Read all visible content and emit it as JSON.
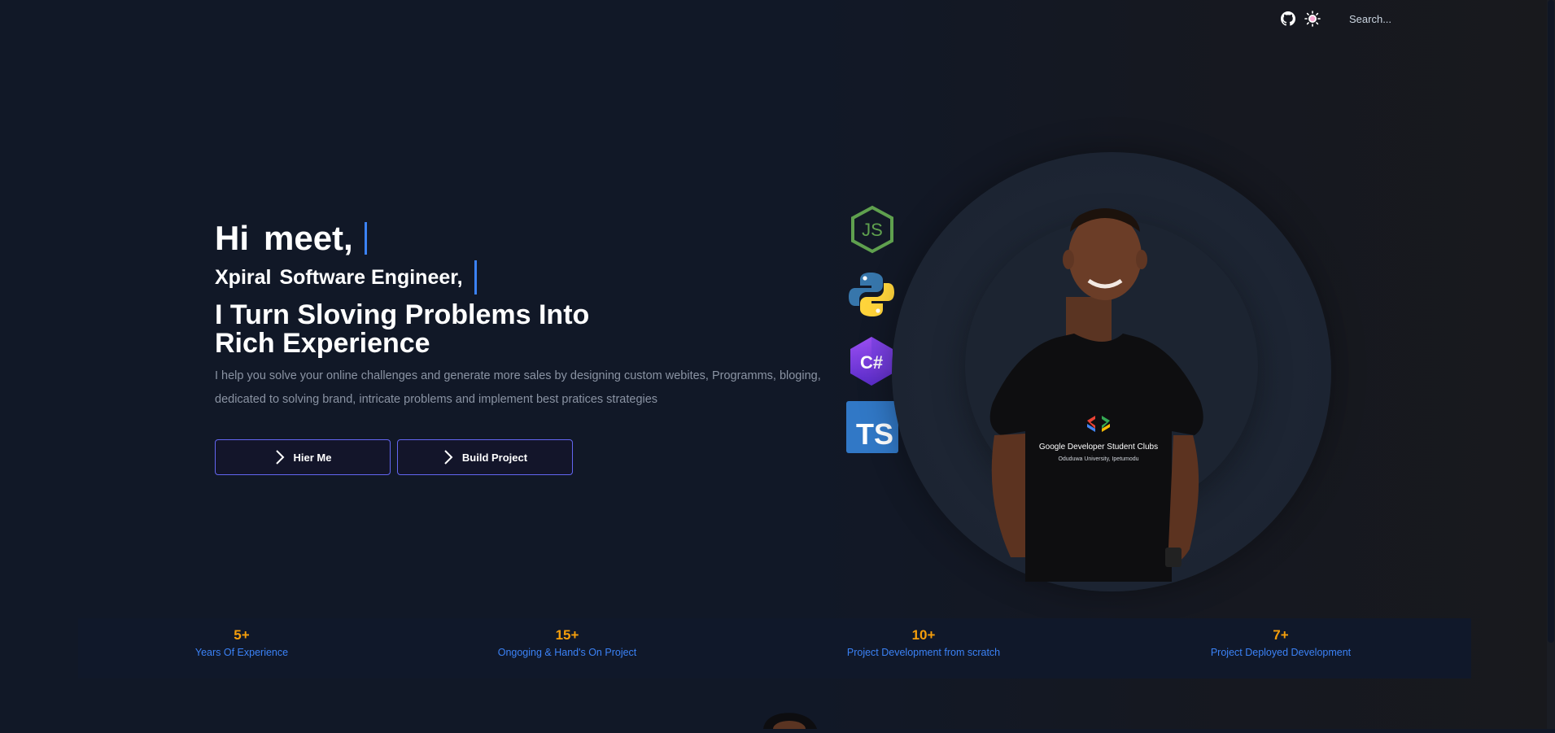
{
  "topbar": {
    "github_icon": "github-icon",
    "theme_icon": "sun-icon",
    "search_placeholder": "Search..."
  },
  "hero": {
    "greeting_word1": "Hi",
    "greeting_word2": "meet,",
    "role_word1": "Xpiral",
    "role_word2": "Software Engineer,",
    "headline_line1": "I Turn Sloving Problems Into",
    "headline_line2": "Rich Experience",
    "description": "I help you solve your online challenges and generate more sales by designing custom webites, Programms, bloging, dedicated to solving brand, intricate problems and implement best pratices strategies",
    "cursor_color": "#3b82f6"
  },
  "buttons": {
    "hire_label": "Hier Me",
    "build_label": "Build Project",
    "border_color": "#6366f1"
  },
  "tech_icons": [
    "nodejs-icon",
    "python-icon",
    "csharp-icon",
    "typescript-icon"
  ],
  "tech_labels": {
    "csharp": "C#",
    "typescript": "TS"
  },
  "shirt": {
    "line1": "Google Developer Student Clubs",
    "line2": "Oduduwa University, Ipetumodu"
  },
  "stats": [
    {
      "value": "5+",
      "label": "Years Of Experience"
    },
    {
      "value": "15+",
      "label": "Ongoging & Hand's On Project"
    },
    {
      "value": "10+",
      "label": "Project Development from scratch"
    },
    {
      "value": "7+",
      "label": "Project Deployed Development"
    }
  ],
  "colors": {
    "background": "#111827",
    "stat_value": "#f59e0b",
    "stat_label": "#3b82f6"
  }
}
